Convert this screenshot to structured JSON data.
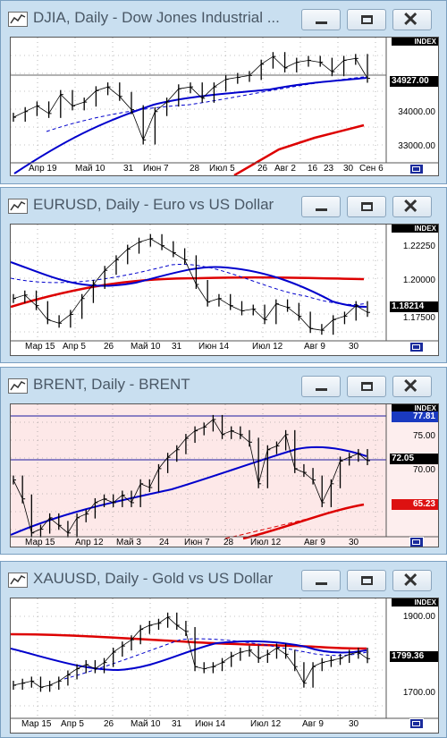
{
  "windows": [
    {
      "title": "DJIA, Daily - Dow Jones Industrial ...",
      "index_label": "INDEX",
      "y_labels": [
        "34000.00",
        "33000.00"
      ],
      "current_price": "34927.00",
      "x_labels": [
        "Апр 19",
        "Май 10",
        "31",
        "Июн 7",
        "28",
        "Июл 5",
        "26",
        "Авг 2",
        "16",
        "23",
        "30",
        "Сен 6"
      ]
    },
    {
      "title": "EURUSD, Daily - Euro vs US Dollar",
      "index_label": "INDEX",
      "y_labels": [
        "1.22250",
        "1.20000",
        "1.17500"
      ],
      "current_price": "1.18214",
      "x_labels": [
        "Мар 15",
        "Апр 5",
        "26",
        "Май 10",
        "31",
        "Июн 14",
        "Июл 12",
        "Авг 9",
        "30"
      ]
    },
    {
      "title": "BRENT, Daily - BRENT",
      "index_label": "INDEX",
      "y_labels": [
        "75.00",
        "70.00"
      ],
      "current_price": "72.05",
      "high_label": "77.81",
      "low_label": "65.23",
      "x_labels": [
        "Мар 15",
        "Апр 12",
        "Май 3",
        "24",
        "Июн 7",
        "28",
        "Июл 12",
        "Авг 9",
        "30"
      ]
    },
    {
      "title": "XAUUSD, Daily - Gold vs US Dollar",
      "index_label": "INDEX",
      "y_labels": [
        "1900.00",
        "1700.00"
      ],
      "current_price": "1799.36",
      "x_labels": [
        "Мар 15",
        "Апр 5",
        "26",
        "Май 10",
        "31",
        "Июн 14",
        "Июл 12",
        "Авг 9",
        "30"
      ]
    }
  ],
  "chart_data": [
    {
      "type": "line",
      "title": "DJIA, Daily - Dow Jones Industrial ...",
      "series": [
        {
          "values": [
            33900,
            34050,
            34200,
            34000,
            34500,
            34200,
            34300,
            34600,
            34700,
            34450,
            34100,
            33300,
            34050,
            34300,
            34650,
            34700,
            34400,
            34700,
            34900,
            34950,
            35000,
            35300,
            35500,
            35200,
            35350,
            35400,
            35350,
            35100,
            35400,
            35450,
            34927
          ]
        }
      ],
      "y_range": [
        32700,
        36000
      ],
      "colors": {
        "price": "#000000",
        "ma_fast": "#0000cc",
        "ma_slow": "#dd0000"
      }
    },
    {
      "type": "line",
      "title": "EURUSD, Daily - Euro vs US Dollar",
      "series": [
        {
          "values": [
            1.19,
            1.192,
            1.186,
            1.178,
            1.176,
            1.181,
            1.19,
            1.198,
            1.206,
            1.212,
            1.218,
            1.222,
            1.224,
            1.22,
            1.216,
            1.212,
            1.198,
            1.188,
            1.19,
            1.186,
            1.183,
            1.184,
            1.178,
            1.187,
            1.185,
            1.18,
            1.173,
            1.172,
            1.178,
            1.18,
            1.186,
            1.18214
          ]
        }
      ],
      "y_range": [
        1.166,
        1.232
      ],
      "colors": {
        "price": "#000000",
        "ma_fast": "#0000cc",
        "ma_slow": "#dd0000"
      }
    },
    {
      "type": "line",
      "title": "BRENT, Daily - BRENT",
      "series": [
        {
          "values": [
            69.5,
            67.0,
            62.5,
            63.0,
            64.5,
            63.5,
            62.5,
            64.5,
            65.0,
            66.5,
            67.0,
            66.5,
            67.5,
            66.5,
            69.0,
            68.5,
            71.0,
            72.5,
            73.5,
            75.0,
            76.0,
            76.5,
            77.5,
            75.5,
            76.0,
            75.5,
            74.5,
            69.0,
            73.5,
            74.0,
            75.5,
            71.0,
            70.5,
            69.5,
            66.5,
            69.0,
            72.0,
            72.5,
            73.0,
            72.05
          ]
        }
      ],
      "y_range": [
        62.0,
        79.5
      ],
      "colors": {
        "price": "#000000",
        "ma_fast": "#0000cc",
        "ma_slow": "#dd0000"
      }
    },
    {
      "type": "line",
      "title": "XAUUSD, Daily - Gold vs US Dollar",
      "series": [
        {
          "values": [
            1735,
            1740,
            1745,
            1730,
            1735,
            1745,
            1760,
            1775,
            1785,
            1775,
            1790,
            1815,
            1830,
            1845,
            1870,
            1880,
            1885,
            1900,
            1880,
            1865,
            1780,
            1775,
            1780,
            1790,
            1805,
            1815,
            1820,
            1800,
            1810,
            1825,
            1810,
            1780,
            1740,
            1780,
            1790,
            1795,
            1800,
            1810,
            1815,
            1799.36
          ]
        }
      ],
      "y_range": [
        1655,
        1945
      ],
      "colors": {
        "price": "#000000",
        "ma_fast": "#0000cc",
        "ma_slow": "#dd0000"
      }
    }
  ]
}
